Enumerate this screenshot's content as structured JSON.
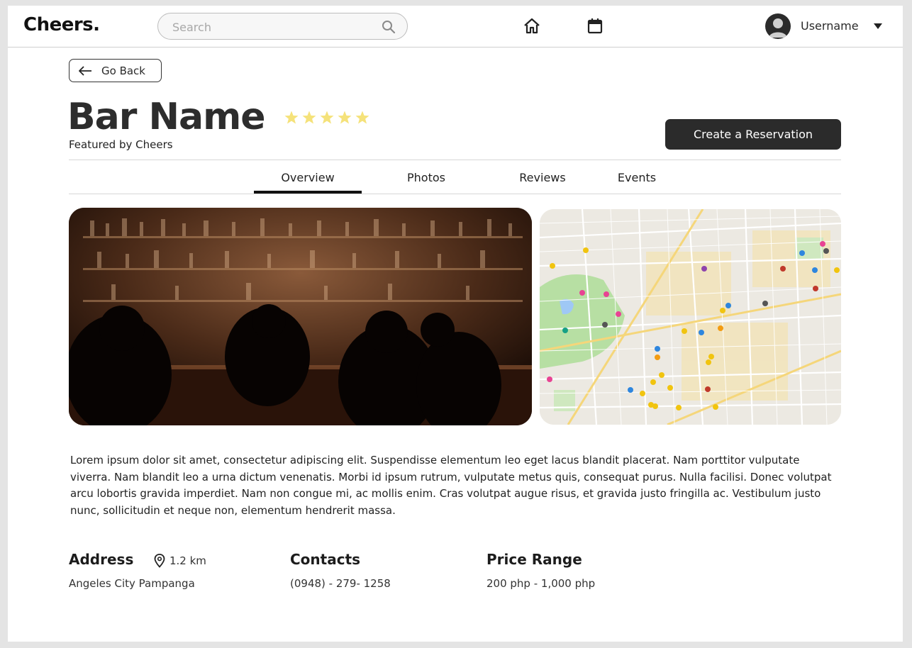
{
  "header": {
    "logo": "Cheers.",
    "search_placeholder": "Search",
    "username": "Username"
  },
  "back_label": "Go Back",
  "bar": {
    "name": "Bar Name",
    "rating": 5,
    "featured": "Featured by Cheers",
    "reserve_label": "Create a Reservation"
  },
  "tabs": [
    {
      "label": "Overview",
      "active": true
    },
    {
      "label": "Photos",
      "active": false
    },
    {
      "label": "Reviews",
      "active": false
    },
    {
      "label": "Events",
      "active": false
    }
  ],
  "description": "Lorem ipsum dolor sit amet, consectetur adipiscing elit. Suspendisse elementum leo eget lacus blandit placerat. Nam porttitor vulputate viverra. Nam blandit leo a urna dictum venenatis. Morbi id ipsum rutrum, vulputate metus quis, consequat purus. Nulla facilisi. Donec volutpat arcu lobortis gravida imperdiet. Nam non congue mi, ac mollis enim. Cras volutpat augue risus, et gravida justo fringilla ac. Vestibulum justo nunc, sollicitudin et neque non, elementum hendrerit massa.",
  "info": {
    "address_title": "Address",
    "distance": "1.2 km",
    "address": "Angeles City Pampanga",
    "contacts_title": "Contacts",
    "phone": "(0948) - 279- 1258",
    "price_title": "Price Range",
    "price": "200 php - 1,000 php"
  },
  "colors": {
    "star": "#f5e27a",
    "primary_button": "#2b2b2b"
  }
}
